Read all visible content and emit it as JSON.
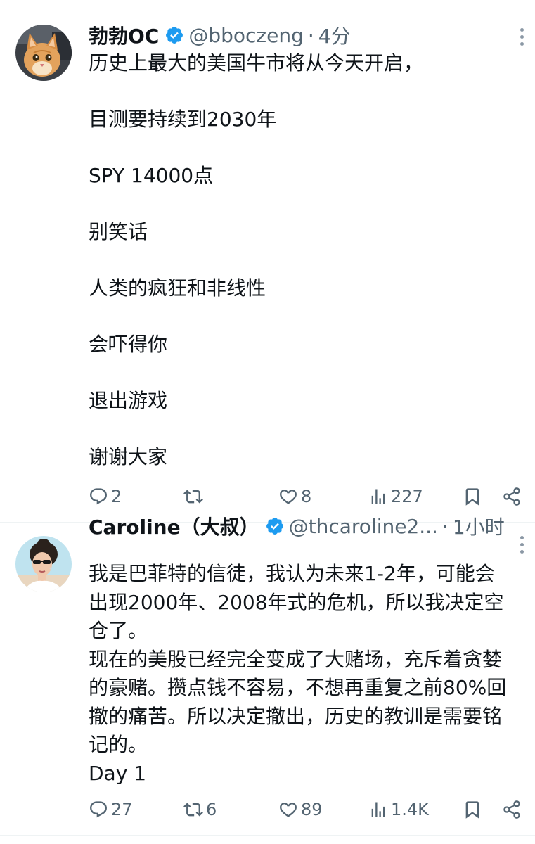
{
  "tweets": [
    {
      "display_name": "勃勃OC",
      "handle": "@bboczeng",
      "separator": "·",
      "time": "4分",
      "lines": [
        "历史上最大的美国牛市将从今天开启，",
        "目测要持续到2030年",
        "SPY 14000点",
        "别笑话",
        "人类的疯狂和非线性",
        "会吓得你",
        "退出游戏",
        "谢谢大家"
      ],
      "replies": "2",
      "retweets": "",
      "likes": "8",
      "views": "227",
      "avatar_icon": "cat-avatar"
    },
    {
      "display_name": "Caroline（大叔）",
      "handle": "@thcaroline2...",
      "separator": "·",
      "time": "1小时",
      "lines": [
        "我是巴菲特的信徒，我认为未来1-2年，可能会",
        "出现2000年、2008年式的危机，所以我决定空",
        "仓了。",
        "现在的美股已经完全变成了大赌场，充斥着贪婪",
        "的豪赌。攒点钱不容易，不想再重复之前80%回",
        "撤的痛苦。所以决定撤出，历史的教训是需要铭",
        "记的。",
        "Day 1"
      ],
      "replies": "27",
      "retweets": "6",
      "likes": "89",
      "views": "1.4K",
      "avatar_icon": "woman-avatar"
    }
  ],
  "colors": {
    "text": "#0f1419",
    "secondary": "#536471",
    "verified": "#1d9bf0",
    "divider": "#eff3f4"
  }
}
